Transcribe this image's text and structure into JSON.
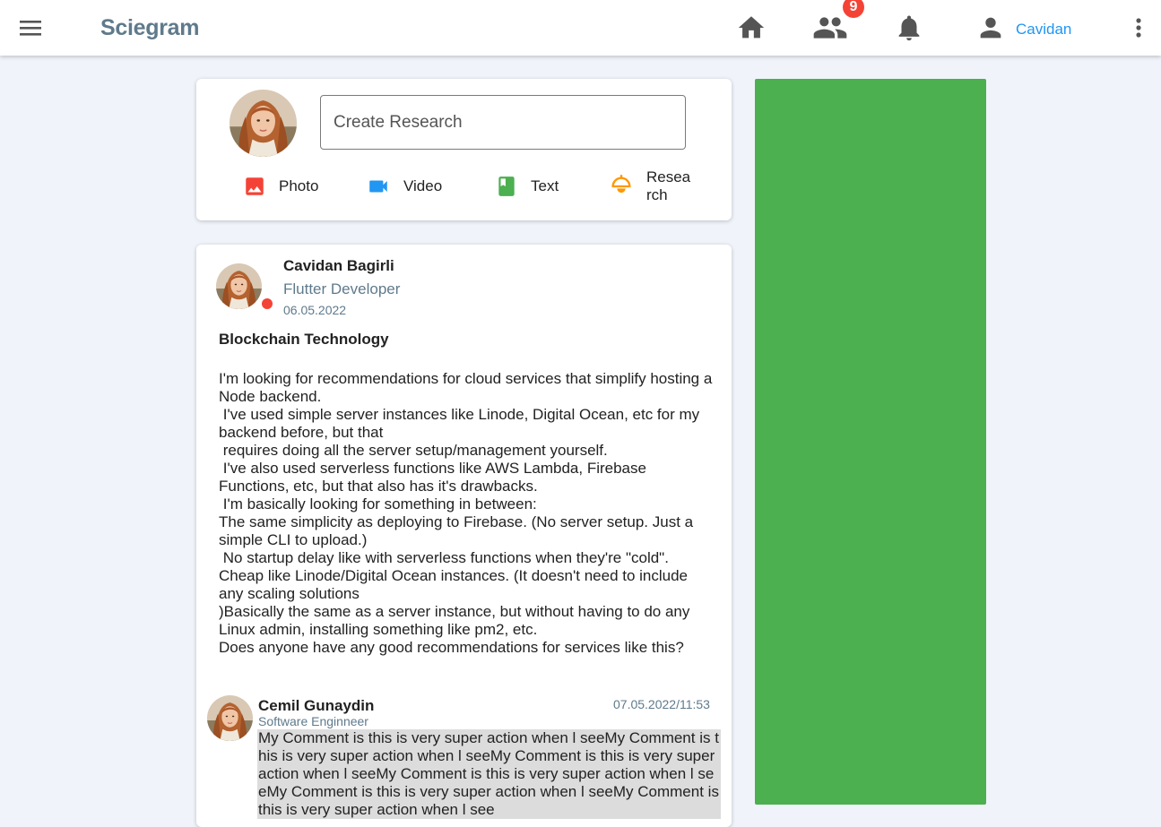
{
  "app": {
    "title": "Sciegram"
  },
  "topbar": {
    "menu_icon": "menu-icon",
    "nav": [
      {
        "name": "home",
        "icon": "home-icon"
      },
      {
        "name": "friends",
        "icon": "people-icon",
        "badge": "9"
      },
      {
        "name": "notifications",
        "icon": "bell-icon"
      }
    ],
    "profile": {
      "icon": "person-icon",
      "name": "Cavidan"
    },
    "more_icon": "more-vert-icon"
  },
  "create_post": {
    "placeholder": "Create Research",
    "actions": [
      {
        "label": "Photo",
        "icon": "image-icon",
        "color": "#f44336"
      },
      {
        "label": "Video",
        "icon": "videocam-icon",
        "color": "#2196f3"
      },
      {
        "label": "Text",
        "icon": "book-icon",
        "color": "#4caf50"
      },
      {
        "label": "Research",
        "icon": "lamp-icon",
        "color": "#ff9800"
      }
    ]
  },
  "post": {
    "author": "Cavidan Bagirli",
    "role": "Flutter Developer",
    "date": "06.05.2022",
    "status_color": "#f44336",
    "title": "Blockchain Technology",
    "body": "I'm looking for recommendations for cloud services that simplify hosting a Node backend.\n I've used simple server instances like Linode, Digital Ocean, etc for my backend before, but that\n requires doing all the server setup/management yourself.\n I've also used serverless functions like AWS Lambda, Firebase Functions, etc, but that also has it's drawbacks.\n I'm basically looking for something in between:\nThe same simplicity as deploying to Firebase. (No server setup. Just a simple CLI to upload.)\n No startup delay like with serverless functions when they're \"cold\".\nCheap like Linode/Digital Ocean instances. (It doesn't need to include any scaling solutions\n)Basically the same as a server instance, but without having to do any Linux admin, installing something like pm2, etc.\nDoes anyone have any good recommendations for services like this?"
  },
  "comment": {
    "author": "Cemil Gunaydin",
    "role": "Software Enginneer",
    "time": "07.05.2022/11:53",
    "text": "My Comment is this is very super action when l seeMy Comment is this is very super action when l seeMy Comment is this is very super action when l seeMy Comment is this is very super action when l seeMy Comment is this is very super action when l seeMy Comment is this is very super action when l see"
  },
  "side_panel": {
    "color": "#4caf50"
  },
  "colors": {
    "accent": "#2196f3",
    "muted": "#5f7a8c",
    "badge": "#f44336",
    "background": "#f0f4fa"
  }
}
